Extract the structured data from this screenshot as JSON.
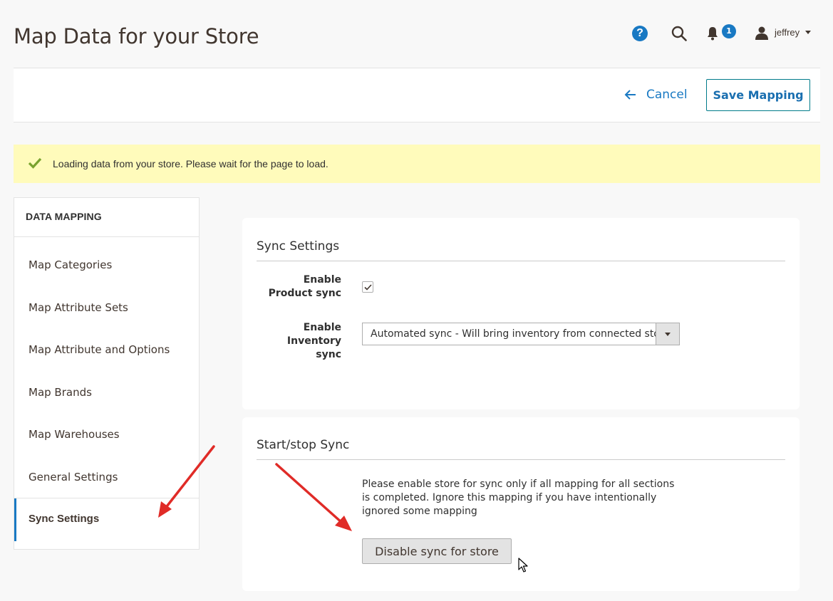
{
  "header": {
    "title": "Map Data for your Store",
    "help_icon": "question-circle-icon",
    "search_icon": "search-icon",
    "notifications_icon": "bell-icon",
    "notification_count": "1",
    "user_icon": "user-icon",
    "user_name": "jeffrey"
  },
  "action_bar": {
    "cancel_label": "Cancel",
    "save_label": "Save Mapping"
  },
  "message": {
    "icon": "check-icon",
    "text": "Loading data from your store. Please wait for the page to load."
  },
  "sidebar": {
    "title": "DATA MAPPING",
    "items": [
      {
        "label": "Map Categories",
        "active": false
      },
      {
        "label": "Map Attribute Sets",
        "active": false
      },
      {
        "label": "Map Attribute and Options",
        "active": false
      },
      {
        "label": "Map Brands",
        "active": false
      },
      {
        "label": "Map Warehouses",
        "active": false
      },
      {
        "label": "General Settings",
        "active": false
      },
      {
        "label": "Sync Settings",
        "active": true
      }
    ]
  },
  "sync_settings": {
    "title": "Sync Settings",
    "product_sync_label_line1": "Enable",
    "product_sync_label_line2": "Product sync",
    "product_sync_checked": true,
    "inventory_sync_label_line1": "Enable",
    "inventory_sync_label_line2": "Inventory",
    "inventory_sync_label_line3": "sync",
    "inventory_sync_value": "Automated sync - Will bring inventory from connected store"
  },
  "start_stop": {
    "title": "Start/stop Sync",
    "note": "Please enable store for sync only if all mapping for all sections is completed. Ignore this mapping if you have intentionally ignored some mapping",
    "button_label": "Disable sync for store"
  },
  "colors": {
    "accent": "#1979c3",
    "annotation_arrow": "#e02b27",
    "message_bg": "#fffbbb",
    "success_check": "#79a22e"
  }
}
